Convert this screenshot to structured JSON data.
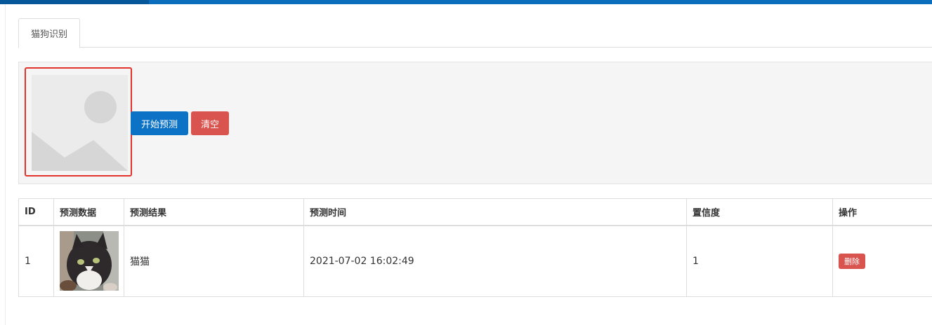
{
  "tabs": [
    {
      "label": "猫狗识别"
    }
  ],
  "upload": {
    "placeholder_icon": "image-placeholder-icon",
    "start_button": "开始预测",
    "clear_button": "清空"
  },
  "colors": {
    "topbar": "#0a6ebd",
    "primary": "#0b72c5",
    "danger": "#d9534f",
    "selection_border": "#e2342d"
  },
  "table": {
    "headers": [
      "ID",
      "预测数据",
      "预测结果",
      "预测时间",
      "置信度",
      "操作"
    ],
    "rows": [
      {
        "id": "1",
        "image": "cat-photo",
        "result": "猫猫",
        "time": "2021-07-02 16:02:49",
        "confidence": "1",
        "action": "删除"
      }
    ]
  }
}
